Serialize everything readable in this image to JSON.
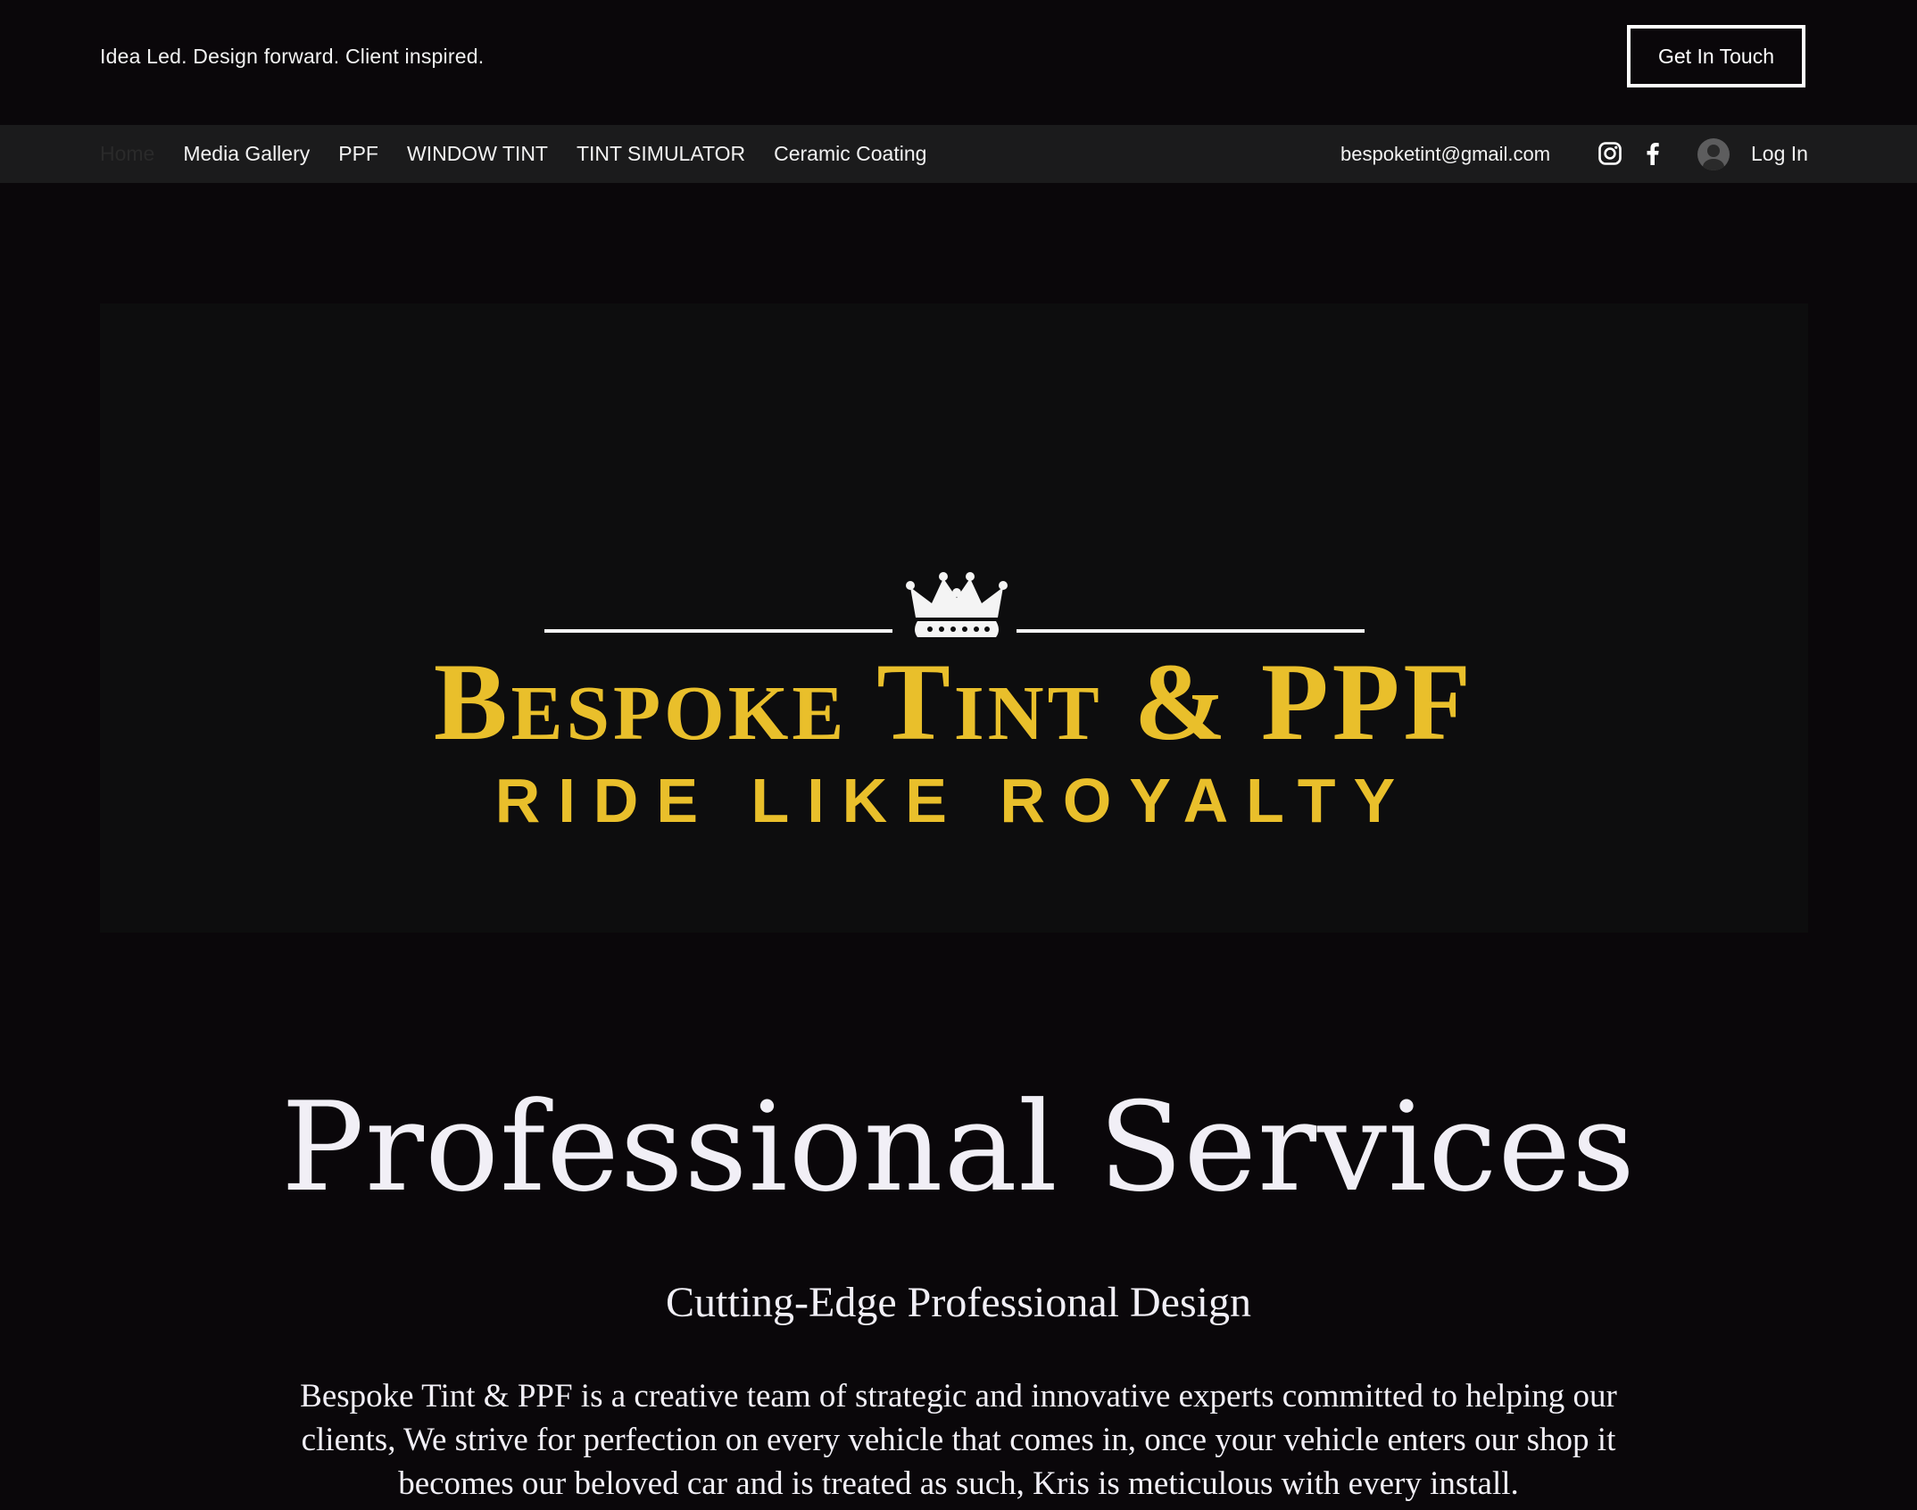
{
  "header": {
    "tagline": "Idea Led. Design forward. Client inspired.",
    "cta_label": "Get In Touch"
  },
  "nav": {
    "items": [
      {
        "label": "Home",
        "current": true
      },
      {
        "label": "Media Gallery"
      },
      {
        "label": "PPF"
      },
      {
        "label": "WINDOW TINT"
      },
      {
        "label": "TINT SIMULATOR"
      },
      {
        "label": "Ceramic Coating"
      }
    ],
    "email": "bespoketint@gmail.com",
    "social": [
      "instagram-icon",
      "facebook-icon"
    ],
    "login_label": "Log In"
  },
  "hero": {
    "brand": "Bespoke Tint & PPF",
    "slogan": "RIDE LIKE ROYALTY",
    "brand_color": "#e9bf2b"
  },
  "main": {
    "heading": "Professional Services",
    "subheading": "Cutting-Edge Professional Design",
    "paragraph": "Bespoke Tint & PPF is a creative team of strategic and innovative experts committed to helping our clients, We strive for perfection on every vehicle that comes in, once your vehicle enters our shop it becomes our beloved car and is treated as such, Kris is meticulous with every install."
  }
}
